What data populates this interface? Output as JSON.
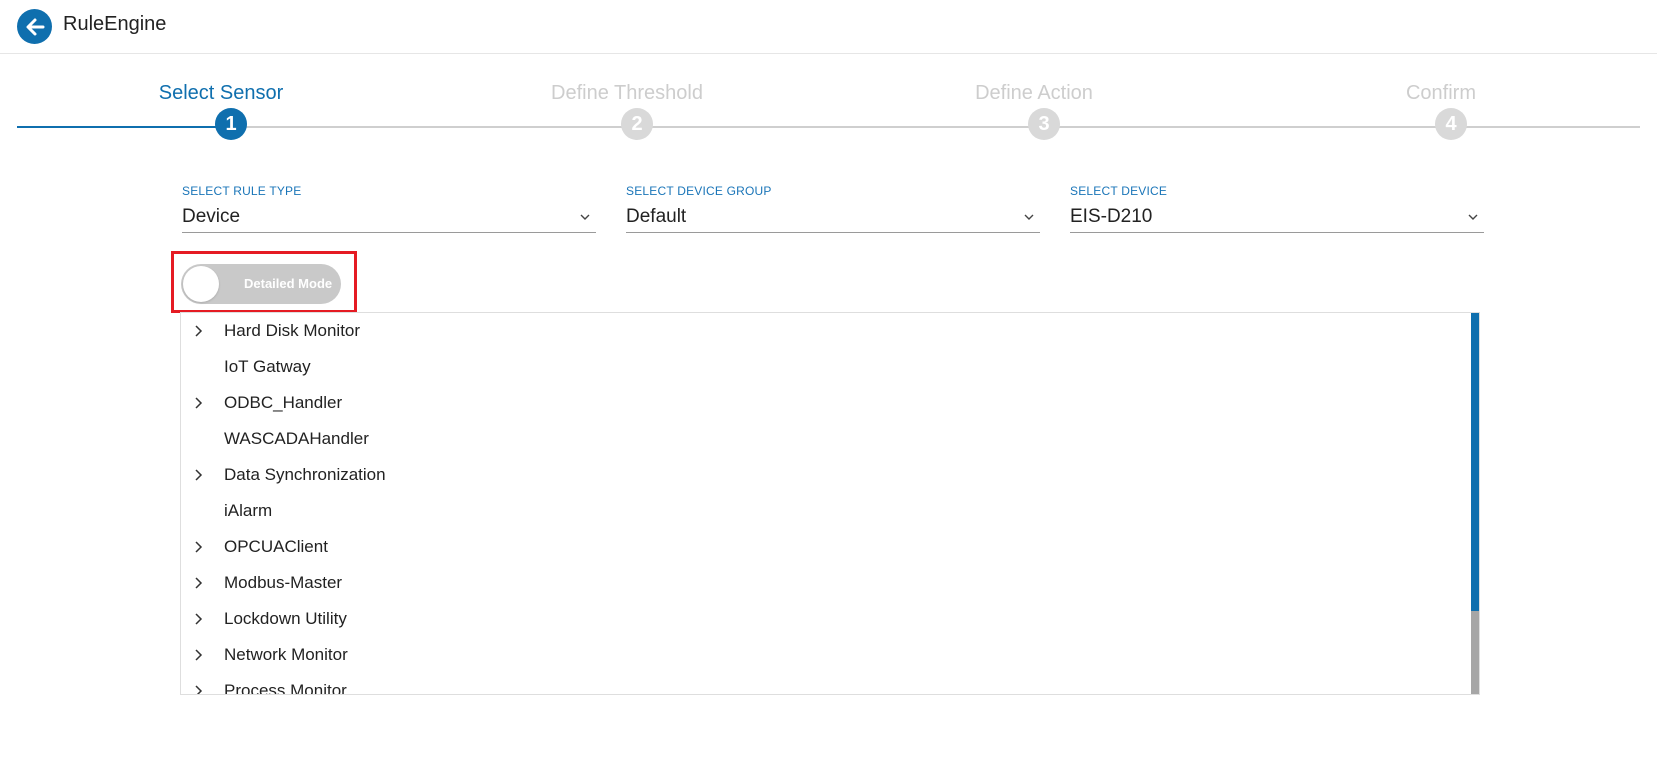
{
  "header": {
    "title": "RuleEngine",
    "back_icon": "arrow-left-icon"
  },
  "colors": {
    "accent": "#0f6fae",
    "inactive_step": "#d9d9d9",
    "highlight": "#e51b23",
    "toggle_off": "#c9c9c9"
  },
  "stepper": {
    "steps": [
      {
        "label": "Select Sensor",
        "number": "1",
        "state": "active"
      },
      {
        "label": "Define Threshold",
        "number": "2",
        "state": "inactive"
      },
      {
        "label": "Define Action",
        "number": "3",
        "state": "inactive"
      },
      {
        "label": "Confirm",
        "number": "4",
        "state": "inactive"
      }
    ]
  },
  "selects": {
    "rule_type": {
      "caption": "SELECT RULE TYPE",
      "value": "Device"
    },
    "device_group": {
      "caption": "SELECT DEVICE GROUP",
      "value": "Default"
    },
    "device": {
      "caption": "SELECT DEVICE",
      "value": "EIS-D210"
    }
  },
  "toggle": {
    "label": "Detailed Mode",
    "checked": false
  },
  "tree": {
    "items": [
      {
        "label": "Hard Disk Monitor",
        "expandable": true
      },
      {
        "label": "IoT Gatway",
        "expandable": false
      },
      {
        "label": "ODBC_Handler",
        "expandable": true
      },
      {
        "label": "WASCADAHandler",
        "expandable": false
      },
      {
        "label": "Data Synchronization",
        "expandable": true
      },
      {
        "label": "iAlarm",
        "expandable": false
      },
      {
        "label": "OPCUAClient",
        "expandable": true
      },
      {
        "label": "Modbus-Master",
        "expandable": true
      },
      {
        "label": "Lockdown Utility",
        "expandable": true
      },
      {
        "label": "Network Monitor",
        "expandable": true
      },
      {
        "label": "Process Monitor",
        "expandable": true
      }
    ]
  }
}
